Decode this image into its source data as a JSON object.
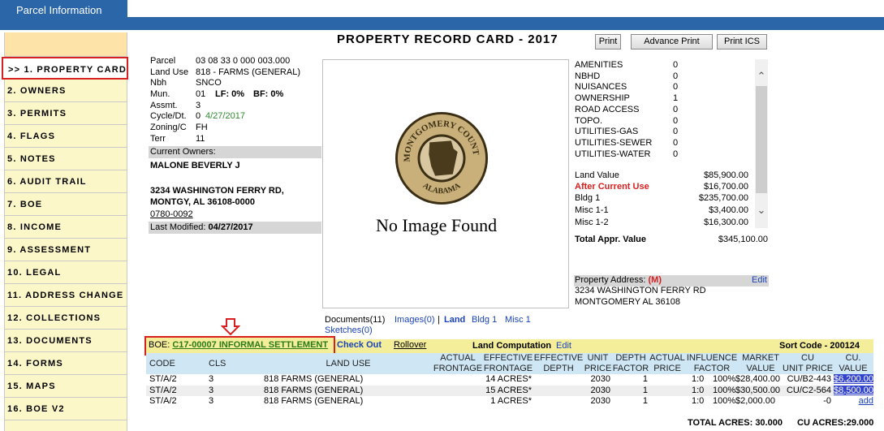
{
  "tab_title": "Parcel Information",
  "page_title": "PROPERTY RECORD CARD - 2017",
  "buttons": {
    "print": "Print",
    "advance_print": "Advance Print",
    "print_ics": "Print ICS"
  },
  "nav": [
    ">> 1. PROPERTY CARD",
    "2. OWNERS",
    "3. PERMITS",
    "4. FLAGS",
    "5. NOTES",
    "6. AUDIT TRAIL",
    "7. BOE",
    "8. INCOME",
    "9. ASSESSMENT",
    "10. LEGAL",
    "11. ADDRESS CHANGE",
    "12. COLLECTIONS",
    "13. DOCUMENTS",
    "14. FORMS",
    "15. MAPS",
    "16. BOE V2"
  ],
  "parcel": {
    "parcel_label": "Parcel",
    "parcel_value": "03 08 33 0 000 003.000",
    "landuse_label": "Land Use",
    "landuse_value": "818 - FARMS (GENERAL)",
    "nbh_label": "Nbh",
    "nbh_value": "SNCO",
    "mun_label": "Mun.",
    "mun_value": "01",
    "lf_label": "LF: 0%",
    "bf_label": "BF: 0%",
    "assmt_label": "Assmt.",
    "assmt_value": "3",
    "cycle_label": "Cycle/Dt.",
    "cycle_value": "0",
    "cycle_date": "4/27/2017",
    "zoning_label": "Zoning/C",
    "zoning_value": "FH",
    "terr_label": "Terr",
    "terr_value": "11",
    "current_owners_label": "Current Owners:",
    "owner_name": "MALONE BEVERLY J",
    "address_line1": "3234 WASHINGTON FERRY RD,",
    "address_line2": "MONTGY, AL  36108-0000",
    "book_page": "0780-0092",
    "last_modified_label": "Last Modified:",
    "last_modified_value": "04/27/2017"
  },
  "image": {
    "no_image_text": "No Image Found",
    "seal_top_text": "MONTGOMERY COUNTY",
    "seal_bottom_text": "ALABAMA"
  },
  "amenities": [
    {
      "label": "AMENITIES",
      "value": "0"
    },
    {
      "label": "NBHD",
      "value": "0"
    },
    {
      "label": "NUISANCES",
      "value": "0"
    },
    {
      "label": "OWNERSHIP",
      "value": "1"
    },
    {
      "label": "ROAD ACCESS",
      "value": "0"
    },
    {
      "label": "TOPO.",
      "value": "0"
    },
    {
      "label": "UTILITIES-GAS",
      "value": "0"
    },
    {
      "label": "UTILITIES-SEWER",
      "value": "0"
    },
    {
      "label": "UTILITIES-WATER",
      "value": "0"
    }
  ],
  "values": {
    "land_value_label": "Land Value",
    "land_value": "$85,900.00",
    "after_current_use_label": "After Current Use",
    "after_current_use": "$16,700.00",
    "bldg1_label": "Bldg 1",
    "bldg1": "$235,700.00",
    "misc11_label": "Misc 1-1",
    "misc11": "$3,400.00",
    "misc12_label": "Misc 1-2",
    "misc12": "$16,300.00",
    "total_label": "Total Appr. Value",
    "total": "$345,100.00"
  },
  "property_address": {
    "label": "Property Address:",
    "flag": "(M)",
    "edit": "Edit",
    "line1": "3234 WASHINGTON FERRY RD",
    "line2": "MONTGOMERY AL 36108"
  },
  "docs": {
    "documents": "Documents(11)",
    "images": "Images(0)",
    "sep": "|",
    "land": "Land",
    "bldg1": "Bldg 1",
    "misc1": "Misc 1",
    "sketches": "Sketches(0)"
  },
  "boe": {
    "label": "BOE:",
    "link": "C17-00007 INFORMAL SETTLEMENT",
    "check_out": "Check Out",
    "rollover": "Rollover",
    "land_computation": "Land Computation",
    "edit": "Edit",
    "sort_code": "Sort Code - 200124"
  },
  "land_table": {
    "headers": {
      "code": "CODE",
      "cls": "CLS",
      "land_use": "LAND USE",
      "actual_frontage": "ACTUAL\nFRONTAGE",
      "effective_frontage": "EFFECTIVE\nFRONTAGE",
      "effective_depth": "EFFECTIVE\nDEPTH",
      "unit_price": "UNIT\nPRICE",
      "depth_factor": "DEPTH\nFACTOR",
      "actual_price": "ACTUAL\nPRICE",
      "influence_factor": "INFLUENCE\nFACTOR",
      "market_value": "MARKET\nVALUE",
      "cu_unit_price": "CU\nUNIT PRICE",
      "cu_value": "CU.\nVALUE"
    },
    "rows": [
      {
        "code": "ST/A/2",
        "cls": "3",
        "land_use": "818 FARMS (GENERAL)",
        "eff_frontage": "14 ACRES*",
        "unit_price": "2030",
        "depth_factor": "1",
        "influence": "1:0",
        "pct": "100%",
        "market_value": "$28,400.00",
        "cu_unit": "CU/B2-443",
        "cu_value": "$6,200.00"
      },
      {
        "code": "ST/A/2",
        "cls": "3",
        "land_use": "818 FARMS (GENERAL)",
        "eff_frontage": "15 ACRES*",
        "unit_price": "2030",
        "depth_factor": "1",
        "influence": "1:0",
        "pct": "100%",
        "market_value": "$30,500.00",
        "cu_unit": "CU/C2-564",
        "cu_value": "$8,500.00"
      },
      {
        "code": "ST/A/2",
        "cls": "3",
        "land_use": "818 FARMS (GENERAL)",
        "eff_frontage": "1 ACRES*",
        "unit_price": "2030",
        "depth_factor": "1",
        "influence": "1:0",
        "pct": "100%",
        "market_value": "$2,000.00",
        "cu_unit": "-0",
        "cu_value": "add"
      }
    ],
    "total_acres": "TOTAL ACRES: 30.000",
    "cu_acres": "CU ACRES:29.000"
  },
  "colors": {
    "header_blue": "#2b66a8",
    "sidebar_bg": "#fbf7c8",
    "highlight_red": "#d92020",
    "boe_bar": "#f4ee9a",
    "table_head": "#cfe7f5"
  }
}
